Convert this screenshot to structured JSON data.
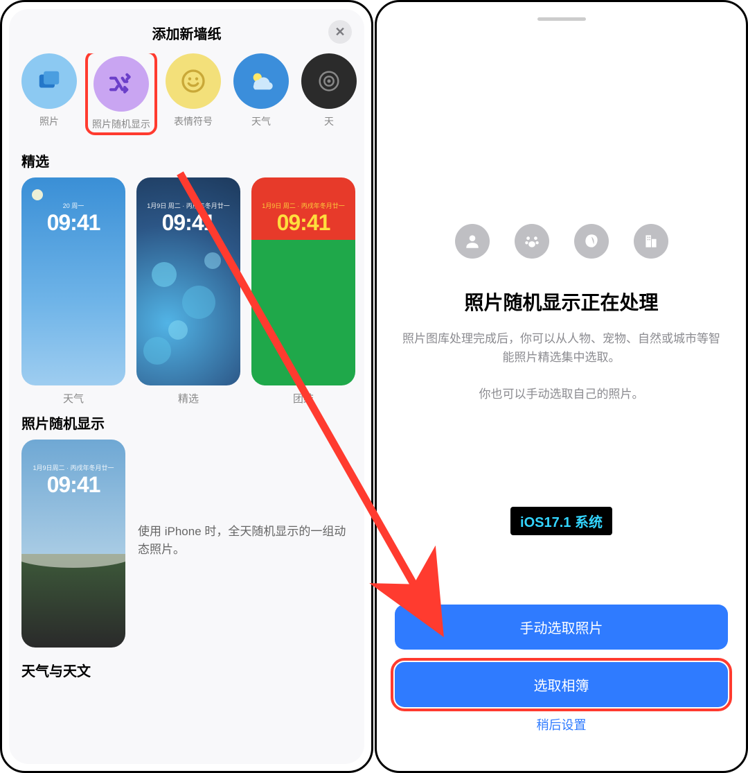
{
  "left": {
    "title": "添加新墙纸",
    "categories": [
      {
        "label": "照片",
        "icon": "photos",
        "bg": "#8cc9f2"
      },
      {
        "label": "照片随机显示",
        "icon": "shuffle",
        "bg": "#c9a5f2",
        "highlighted": true
      },
      {
        "label": "表情符号",
        "icon": "emoji",
        "bg": "#f3e07a"
      },
      {
        "label": "天气",
        "icon": "weather",
        "bg": "#3b8edb"
      },
      {
        "label": "天",
        "icon": "astro",
        "bg": "#2b2b2b"
      }
    ],
    "featured": {
      "heading": "精选",
      "items": [
        {
          "label": "天气",
          "date": "20 周一",
          "time": "09:41",
          "bg": "weather"
        },
        {
          "label": "精选",
          "date": "1月9日 周二 · 丙戌年冬月廿一",
          "time": "09:41",
          "bg": "bokeh"
        },
        {
          "label": "团结",
          "date": "1月9日 周二 · 丙戌年冬月廿一",
          "time": "09:41",
          "bg": "unity"
        }
      ]
    },
    "shuffle": {
      "heading": "照片随机显示",
      "date": "1月9日周二 · 丙戌年冬月廿一",
      "time": "09:41",
      "description": "使用 iPhone 时，全天随机显示的一组动态照片。"
    },
    "weather_heading": "天气与天文"
  },
  "right": {
    "title": "照片随机显示正在处理",
    "body_line1": "照片图库处理完成后，你可以从人物、宠物、自然或城市等智能照片精选集中选取。",
    "body_line2": "你也可以手动选取自己的照片。",
    "badge": "iOS17.1 系统",
    "btn_manual": "手动选取照片",
    "btn_album": "选取相簿",
    "link_later": "稍后设置",
    "filter_icons": [
      "person",
      "paw",
      "leaf",
      "building"
    ]
  },
  "colors": {
    "accent": "#2f7bff",
    "highlight": "#ff3b2f"
  }
}
